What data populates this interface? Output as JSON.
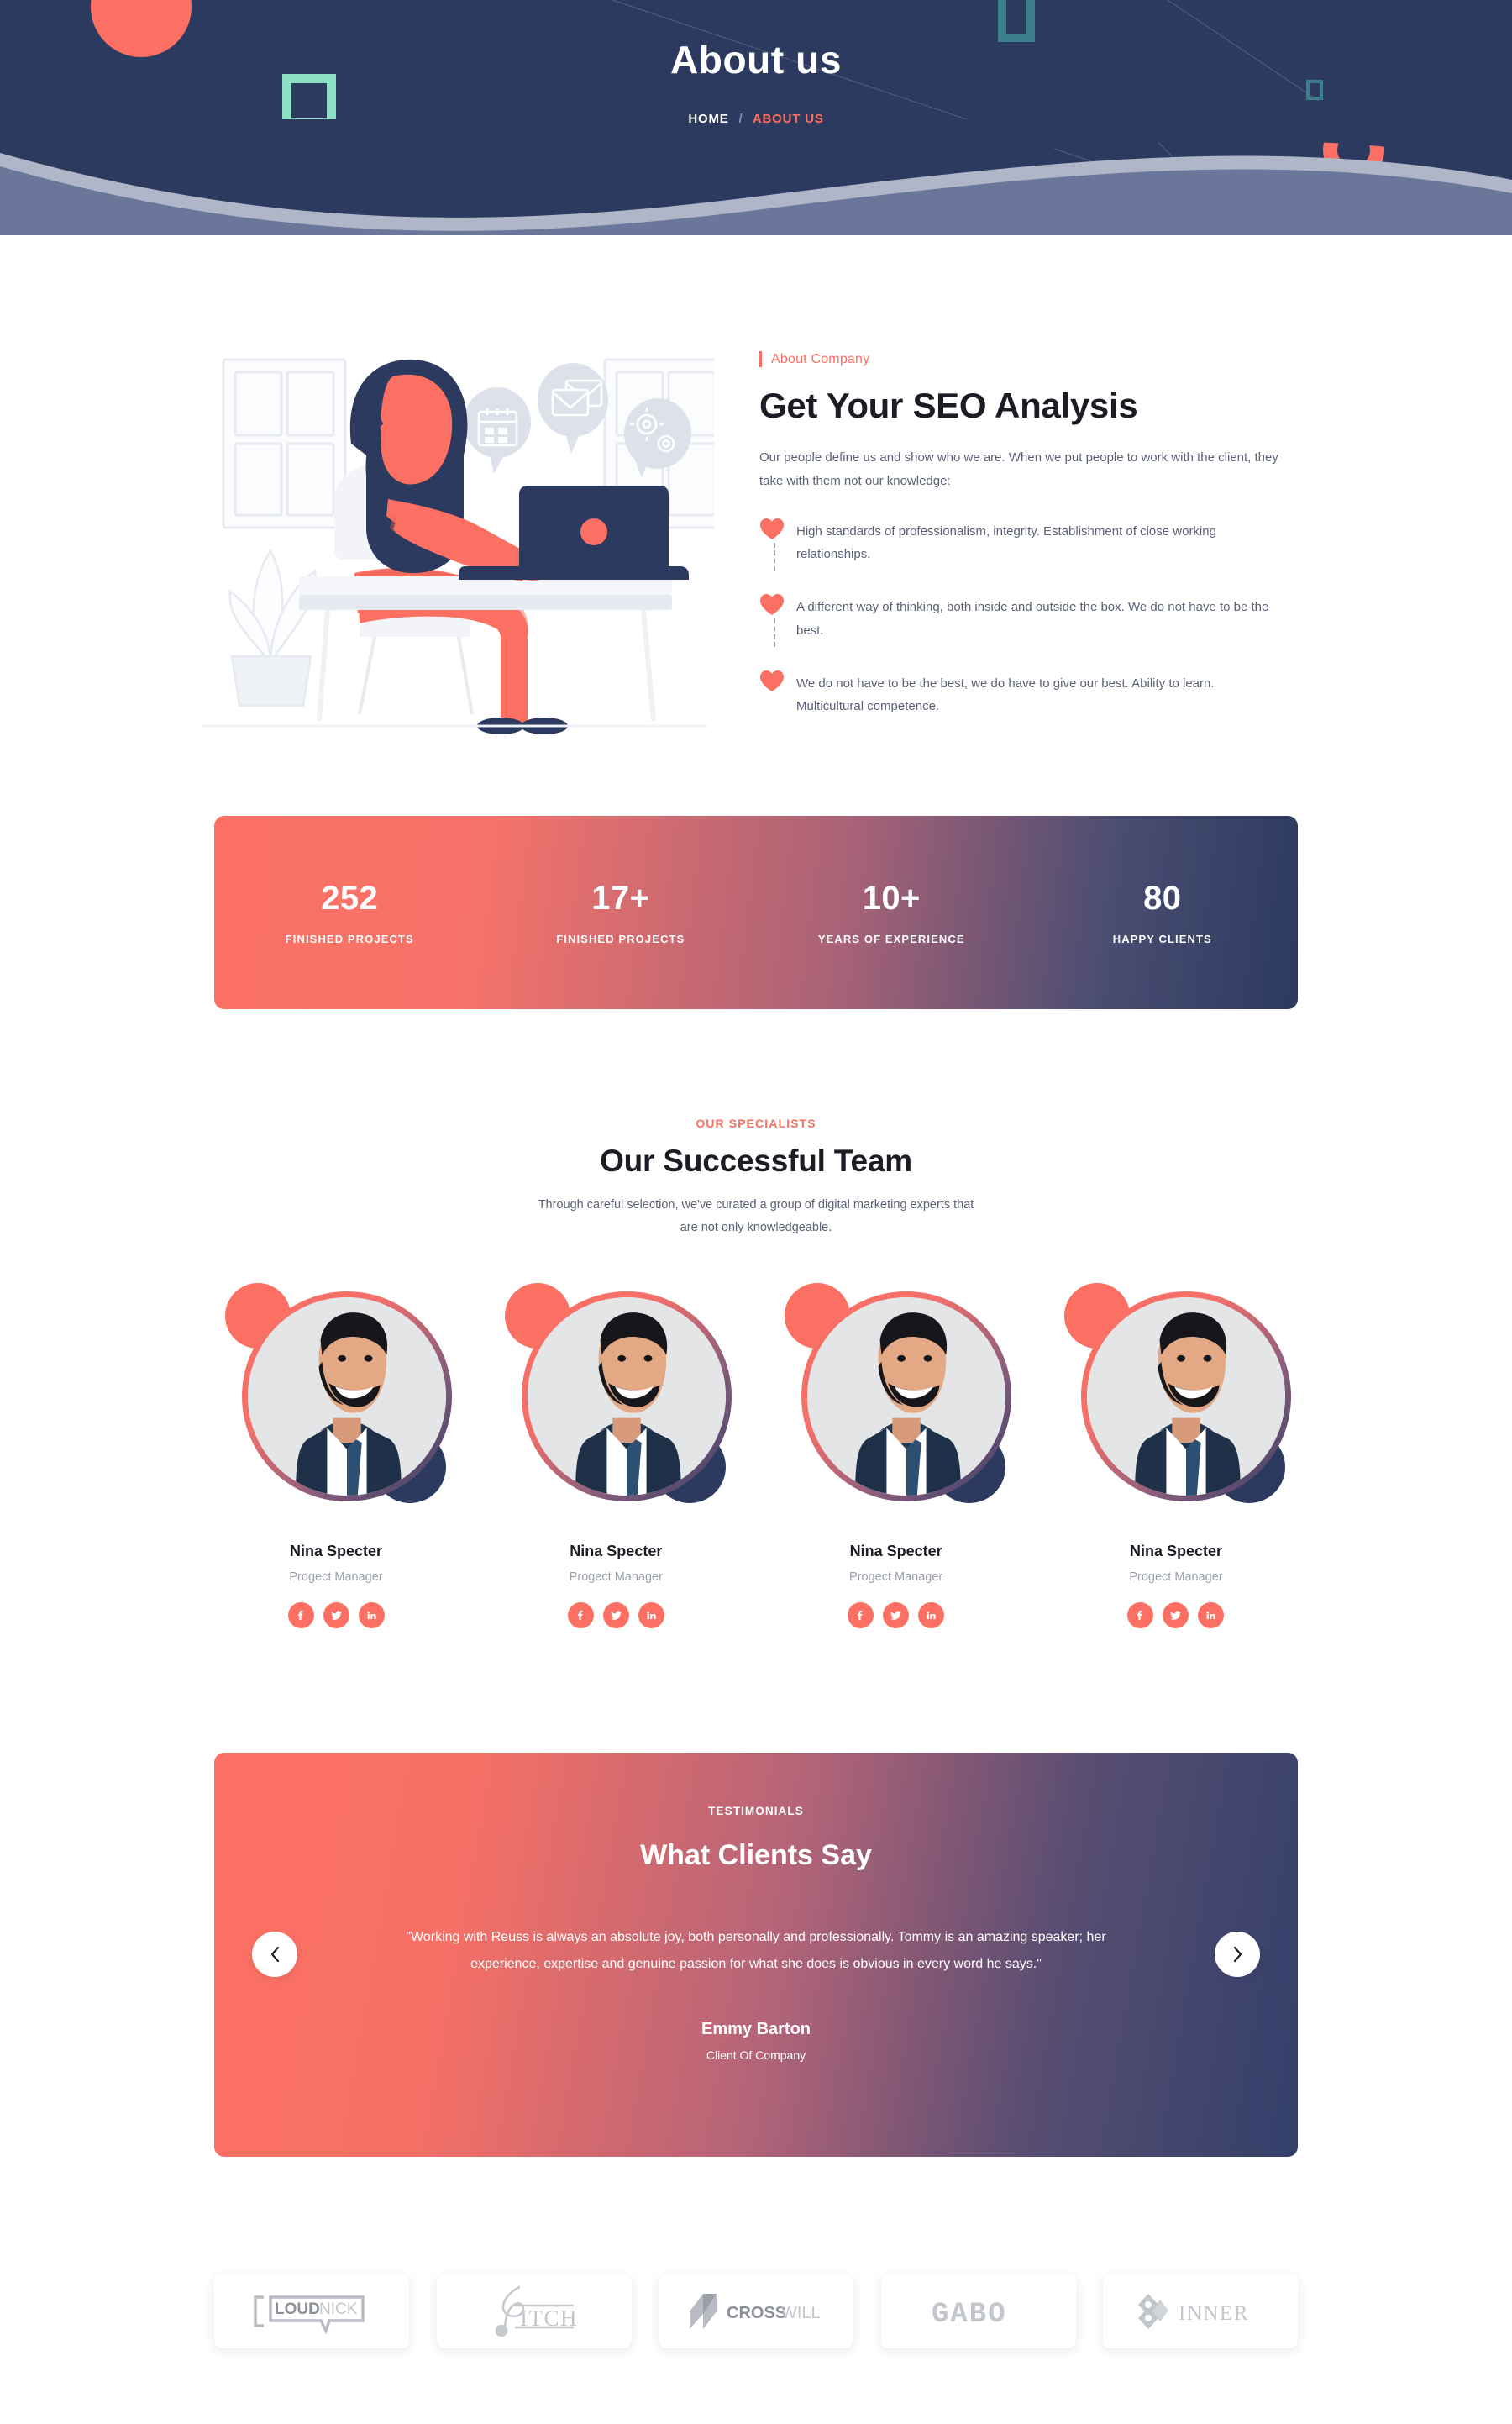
{
  "hero": {
    "title": "About us",
    "breadcrumb": {
      "home": "HOME",
      "separator": "/",
      "current": "ABOUT US"
    }
  },
  "about": {
    "eyebrow": "About Company",
    "title": "Get Your SEO Analysis",
    "lead": "Our people define us and show who we are. When we put people to work with the client, they take with them not our knowledge:",
    "features": [
      "High standards of professionalism, integrity. Establishment of close working relationships.",
      "A different way of thinking, both inside and outside the box. We do not have to be the best.",
      "We do not have to be the best, we do have to give our best. Ability to learn. Multicultural competence."
    ]
  },
  "stats": [
    {
      "value": "252",
      "label": "FINISHED PROJECTS"
    },
    {
      "value": "17+",
      "label": "FINISHED PROJECTS"
    },
    {
      "value": "10+",
      "label": "YEARS OF EXPERIENCE"
    },
    {
      "value": "80",
      "label": "HAPPY CLIENTS"
    }
  ],
  "team": {
    "eyebrow": "OUR SPECIALISTS",
    "title": "Our Successful Team",
    "subtitle": "Through careful selection, we've curated a group of digital marketing experts that are not only knowledgeable.",
    "members": [
      {
        "name": "Nina Specter",
        "role": "Progect Manager",
        "socials": [
          "facebook-icon",
          "twitter-icon",
          "linkedin-icon"
        ]
      },
      {
        "name": "Nina Specter",
        "role": "Progect Manager",
        "socials": [
          "facebook-icon",
          "twitter-icon",
          "linkedin-icon"
        ]
      },
      {
        "name": "Nina Specter",
        "role": "Progect Manager",
        "socials": [
          "facebook-icon",
          "twitter-icon",
          "linkedin-icon"
        ]
      },
      {
        "name": "Nina Specter",
        "role": "Progect Manager",
        "socials": [
          "facebook-icon",
          "twitter-icon",
          "linkedin-icon"
        ]
      }
    ]
  },
  "testimonials": {
    "eyebrow": "TESTIMONIALS",
    "title": "What Clients Say",
    "quote": "\"Working with Reuss is always an absolute joy, both personally and professionally. Tommy is an amazing speaker; her experience, expertise and genuine passion for what she does is obvious in every word he says.\"",
    "author": "Emmy Barton",
    "role": "Client Of Company",
    "prev_label": "‹",
    "next_label": "›"
  },
  "brands": [
    {
      "name": "LOUDNICK",
      "part1": "LOUD",
      "part2": "NICK"
    },
    {
      "name": "PITCH",
      "part1": "",
      "part2": "ITCH"
    },
    {
      "name": "CROSSWILL",
      "part1": "CROSS",
      "part2": "WILL"
    },
    {
      "name": "GABO",
      "part1": "GABO",
      "part2": ""
    },
    {
      "name": "INNER",
      "part1": "",
      "part2": "INNER"
    }
  ],
  "colors": {
    "navy": "#2B3A5E",
    "coral": "#FB7063",
    "mint": "#8BE0C6",
    "teal": "#3E7F8D",
    "body_text": "#5b6275",
    "heading": "#1c1c24"
  }
}
